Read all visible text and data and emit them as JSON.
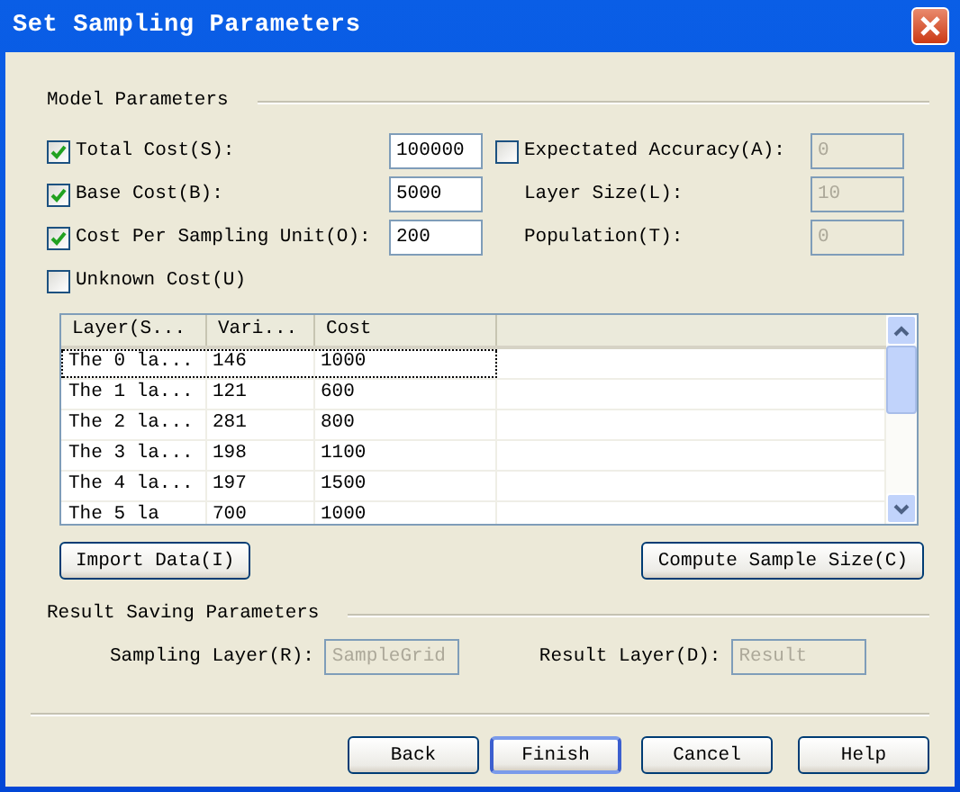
{
  "window": {
    "title": "Set Sampling Parameters"
  },
  "model_parameters": {
    "title": "Model Parameters",
    "rows": [
      {
        "left": {
          "kind": "checkbox-field",
          "label": "Total Cost(S):",
          "checked": true,
          "value": "100000",
          "disabled": false
        },
        "right": {
          "kind": "checkbox-field",
          "label": "Expectated Accuracy(A):",
          "checked": false,
          "value": "0",
          "disabled": true
        }
      },
      {
        "left": {
          "kind": "checkbox-field",
          "label": "Base Cost(B):",
          "checked": true,
          "value": "5000",
          "disabled": false
        },
        "right": {
          "kind": "label-field",
          "label": "Layer Size(L):",
          "value": "10",
          "disabled": true
        }
      },
      {
        "left": {
          "kind": "checkbox-field",
          "label": "Cost Per Sampling Unit(O):",
          "checked": true,
          "value": "200",
          "disabled": false
        },
        "right": {
          "kind": "label-field",
          "label": "Population(T):",
          "value": "0",
          "disabled": true
        }
      },
      {
        "left": {
          "kind": "checkbox",
          "label": "Unknown Cost(U)",
          "checked": false
        }
      }
    ]
  },
  "table": {
    "columns": [
      "Layer(S...",
      "Vari...",
      "Cost"
    ],
    "rows": [
      {
        "cells": [
          "The 0 la...",
          "146",
          "1000"
        ],
        "focused": true
      },
      {
        "cells": [
          "The 1 la...",
          "121",
          "600"
        ],
        "focused": false
      },
      {
        "cells": [
          "The 2 la...",
          "281",
          "800"
        ],
        "focused": false
      },
      {
        "cells": [
          "The 3 la...",
          "198",
          "1100"
        ],
        "focused": false
      },
      {
        "cells": [
          "The 4 la...",
          "197",
          "1500"
        ],
        "focused": false
      },
      {
        "cells": [
          "The 5 la",
          "700",
          "1000"
        ],
        "focused": false
      }
    ]
  },
  "table_buttons": [
    "Import Data(I)",
    "Compute Sample Size(C)"
  ],
  "result_saving": {
    "title": "Result Saving Parameters",
    "fields": [
      {
        "label": "Sampling Layer(R):",
        "value": "SampleGrid",
        "disabled": true
      },
      {
        "label": "Result Layer(D):",
        "value": "Result",
        "disabled": true
      }
    ]
  },
  "buttons": [
    {
      "label": "Back",
      "default": false
    },
    {
      "label": "Finish",
      "default": true
    },
    {
      "label": "Cancel",
      "default": false
    },
    {
      "label": "Help",
      "default": false
    }
  ]
}
